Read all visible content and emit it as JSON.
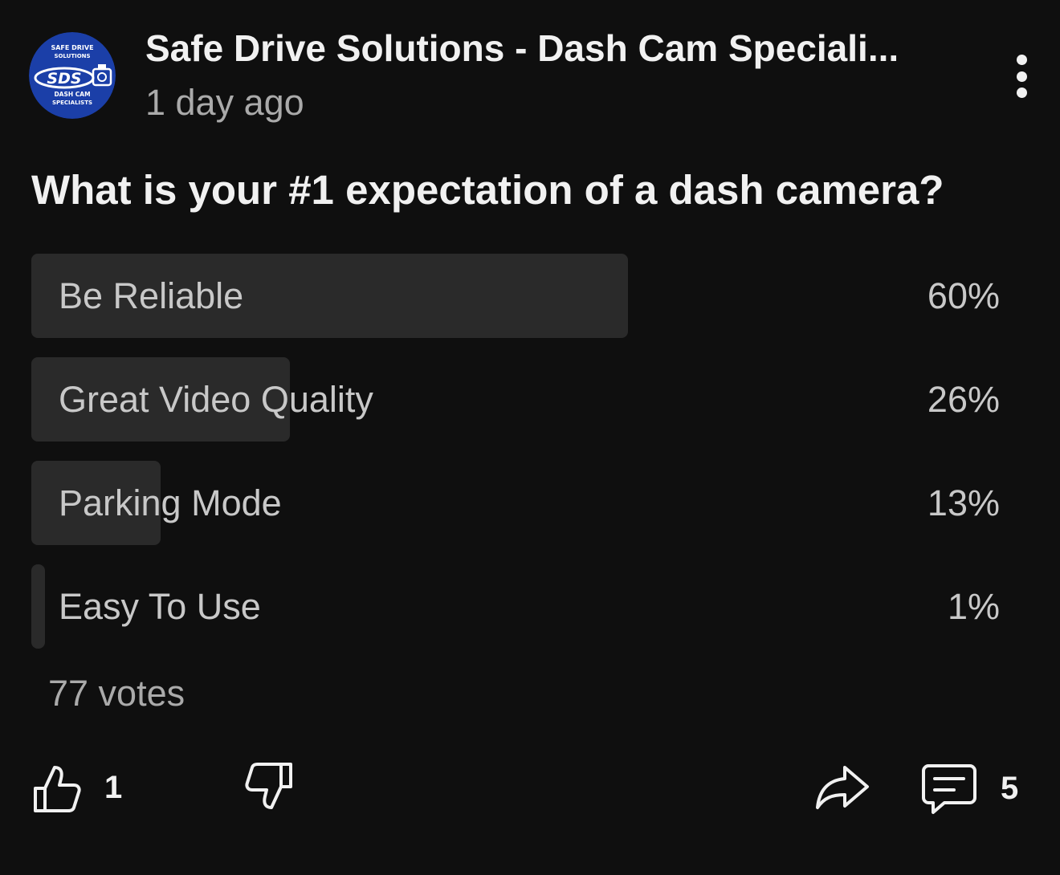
{
  "post": {
    "channel_name": "Safe Drive Solutions - Dash Cam Speciali...",
    "timestamp": "1 day ago",
    "avatar": {
      "line1": "SAFE DRIVE",
      "line2": "SOLUTIONS",
      "monogram": "SDS",
      "line3": "DASH CAM",
      "line4": "SPECIALISTS",
      "bg_color": "#1b3fa8"
    },
    "menu_icon": "more-vertical-icon"
  },
  "poll": {
    "question": "What is your #1 expectation of a dash camera?",
    "options": [
      {
        "label": "Be Reliable",
        "percent_text": "60%",
        "fraction": 0.6
      },
      {
        "label": "Great Video Quality",
        "percent_text": "26%",
        "fraction": 0.26
      },
      {
        "label": "Parking Mode",
        "percent_text": "13%",
        "fraction": 0.13
      },
      {
        "label": "Easy To Use",
        "percent_text": "1%",
        "fraction": 0.01
      }
    ],
    "votes": "77 votes",
    "bar_color": "#2a2a2a"
  },
  "actions": {
    "like_count": "1",
    "comment_count": "5",
    "like_icon": "thumbs-up-icon",
    "dislike_icon": "thumbs-down-icon",
    "share_icon": "share-icon",
    "comment_icon": "comment-icon"
  }
}
